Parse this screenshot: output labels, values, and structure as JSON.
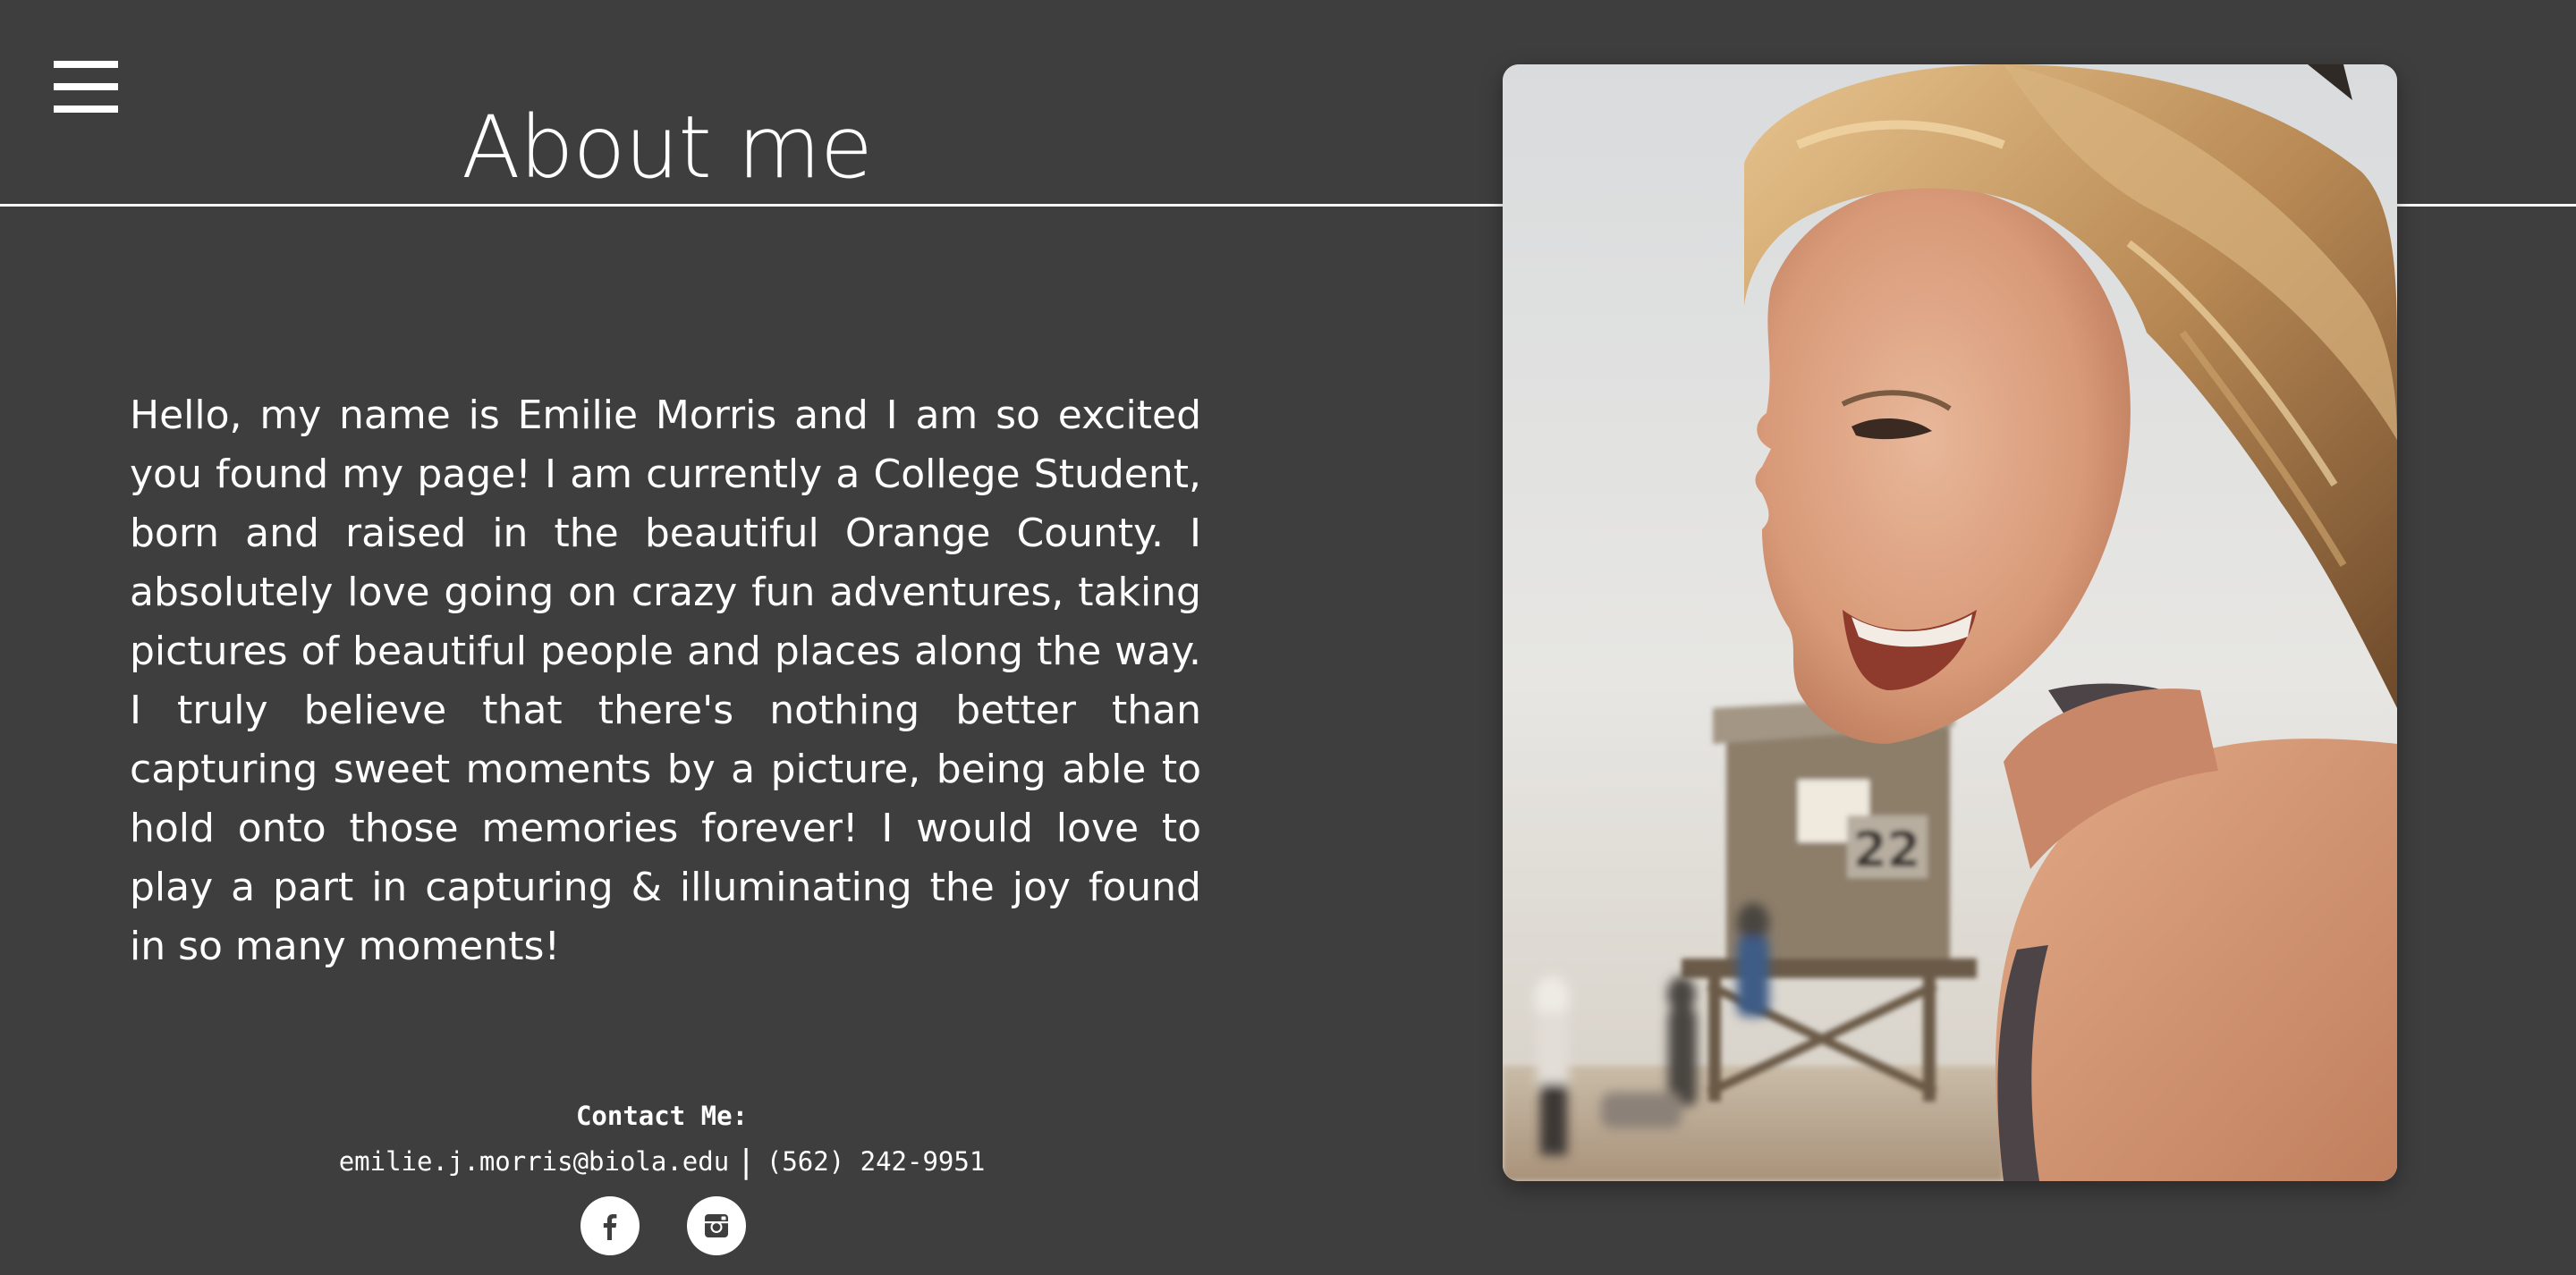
{
  "header": {
    "menu_icon": "hamburger-menu-icon",
    "title": "About me"
  },
  "bio": {
    "text": "Hello, my name is Emilie Morris and I am so excited you found my page! I am currently a College Student, born and raised in the beautiful Orange County. I absolutely love going on crazy fun adventures, taking pictures of beautiful people and places along the way. I truly believe that there's nothing better than capturing sweet moments by a picture, being able to hold onto those memories forever! I would love to play a part in capturing & illuminating the joy found in so many moments!"
  },
  "contact": {
    "heading": "Contact Me:",
    "email": "emilie.j.morris@biola.edu",
    "separator": "|",
    "phone": "(562) 242-9951"
  },
  "social": [
    {
      "icon": "facebook-icon"
    },
    {
      "icon": "instagram-icon"
    }
  ],
  "photo": {
    "subject": "smiling woman with windswept blonde hair at the beach, lifeguard tower numbered 22 in background",
    "tower_number": "22"
  },
  "colors": {
    "background": "#3e3e3e",
    "text": "#ffffff",
    "rule": "#ffffff"
  }
}
